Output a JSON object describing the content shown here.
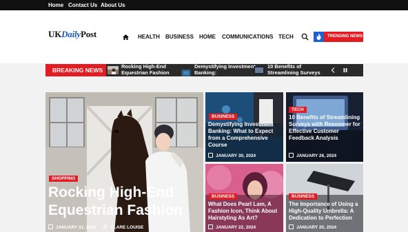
{
  "topbar": {
    "links": [
      {
        "label": "Home"
      },
      {
        "label": "Contact Us"
      },
      {
        "label": "About Us"
      }
    ]
  },
  "header": {
    "logo": {
      "uk": "UK",
      "daily": "Daily",
      "post": "Post"
    },
    "nav": [
      {
        "label": "HEALTH"
      },
      {
        "label": "BUSINESS"
      },
      {
        "label": "HOME"
      },
      {
        "label": "COMMUNICATIONS"
      },
      {
        "label": "TECH"
      }
    ],
    "trending_label": "TRENDING NEWS"
  },
  "breaking": {
    "label": "BREAKING NEWS",
    "items": [
      {
        "title": "Rocking High-End Equestrian Fashion"
      },
      {
        "title": "Demystifying Investment Banking:"
      },
      {
        "title": "10 Benefits of Streamlining Surveys"
      }
    ],
    "prev_icon": "chevron-left-icon",
    "pause_icon": "pause-icon"
  },
  "featured": {
    "category": "SHOPPING",
    "title": "Rocking High-End Equestrian Fashion",
    "date": "JANUARY 31, 2024",
    "author": "CLARE LOUISE"
  },
  "cards": [
    {
      "category": "BUSINESS",
      "title": "Demystifying Investment Banking: What to Expect from a Comprehensive Course",
      "date": "JANUARY 30, 2024"
    },
    {
      "category": "TECH",
      "title": "10 Benefits of Streamlining Surveys with Resoomer for Effective Customer Feedback Analysis",
      "date": "JANUARY 26, 2024"
    },
    {
      "category": "BUSINESS",
      "title": "What Does Pearl Lam, A Fashion Icon, Think About Hairstyling As Art?",
      "date": "JANUARY 22, 2024"
    },
    {
      "category": "BUSINESS",
      "title": "The Importance of Using a High-Quality Umbrella: A Dedication to Perfection",
      "date": "JANUARY 20, 2024"
    }
  ],
  "colors": {
    "accent": "#e31c23",
    "brand_blue": "#1f5fd0",
    "dark": "#111111"
  }
}
